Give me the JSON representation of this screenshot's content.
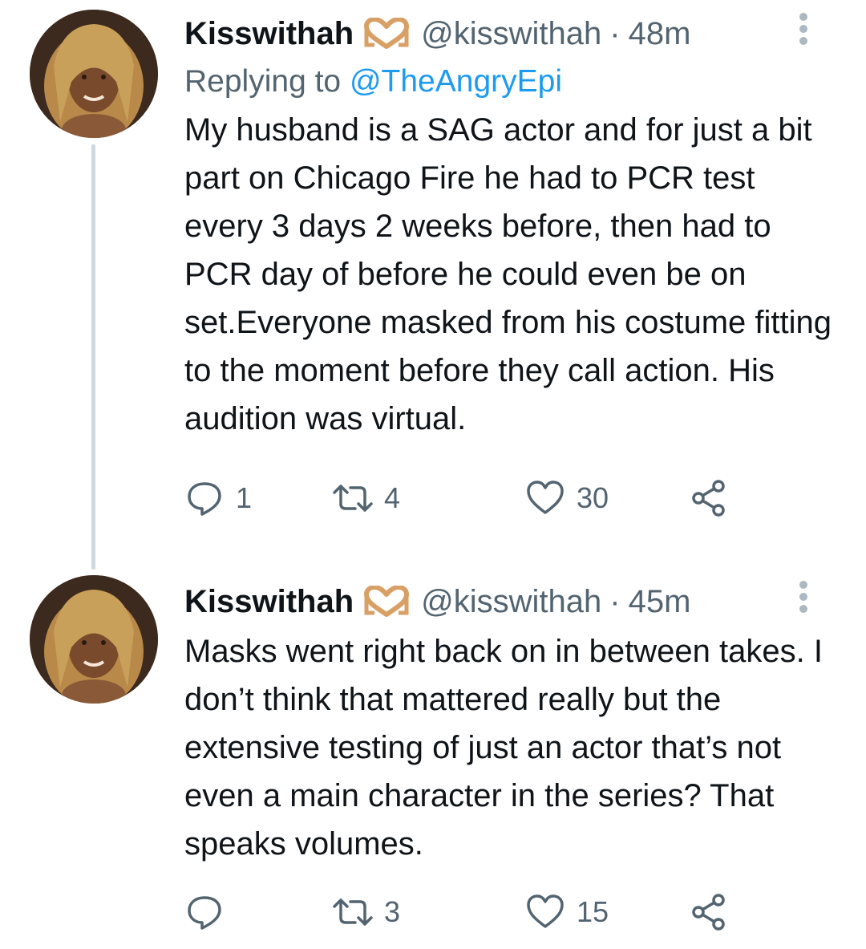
{
  "tweets": [
    {
      "author_name": "Kisswithah",
      "badge_icon": "heart-hands-emoji",
      "handle": "@kisswithah",
      "separator": "·",
      "time": "48m",
      "replying_prefix": "Replying to ",
      "replying_to": "@TheAngryEpi",
      "text": "My husband is a SAG actor and for just a bit part on Chicago Fire he had to PCR test every 3 days 2 weeks before, then had to PCR day of before he could even be on set.Everyone masked from his costume fitting to the moment before they call action. His audition was virtual.",
      "reply_count": "1",
      "retweet_count": "4",
      "like_count": "30"
    },
    {
      "author_name": "Kisswithah",
      "badge_icon": "heart-hands-emoji",
      "handle": "@kisswithah",
      "separator": "·",
      "time": "45m",
      "text": "Masks went right back on in between takes. I don’t think that mattered really but the extensive testing of just an actor that’s not even a main character in the series? That speaks volumes.",
      "reply_count": "",
      "retweet_count": "3",
      "like_count": "15"
    }
  ],
  "colors": {
    "text_primary": "#0f1419",
    "text_secondary": "#536471",
    "link": "#1d9bf0",
    "thread_line": "#cfd9de",
    "badge": "#d9a066"
  }
}
